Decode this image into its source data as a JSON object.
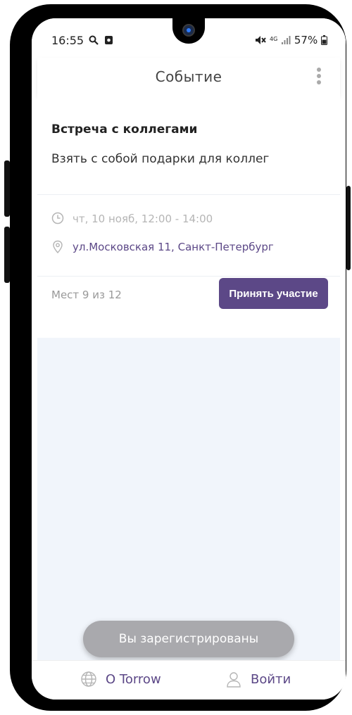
{
  "status_bar": {
    "time": "16:55",
    "network": "4G",
    "battery": "57%"
  },
  "appbar": {
    "title": "Событие"
  },
  "event": {
    "title": "Встреча с коллегами",
    "description": "Взять с собой подарки для коллег",
    "datetime": "чт, 10 нояб, 12:00 - 14:00",
    "address": "ул.Московская 11, Санкт-Петербург",
    "seats": "Мест 9 из 12",
    "join_label": "Принять участие"
  },
  "toast": {
    "text": "Вы зарегистрированы"
  },
  "bottom_nav": {
    "about_label": "О Torrow",
    "login_label": "Войти"
  },
  "colors": {
    "accent": "#5c4887",
    "background": "#f1f5fb",
    "toast": "#a9a9ad"
  },
  "icons": [
    "search-icon",
    "media-icon",
    "mute-icon",
    "signal-icon",
    "battery-icon",
    "more-vert-icon",
    "clock-icon",
    "location-pin-icon",
    "globe-icon",
    "user-icon"
  ]
}
